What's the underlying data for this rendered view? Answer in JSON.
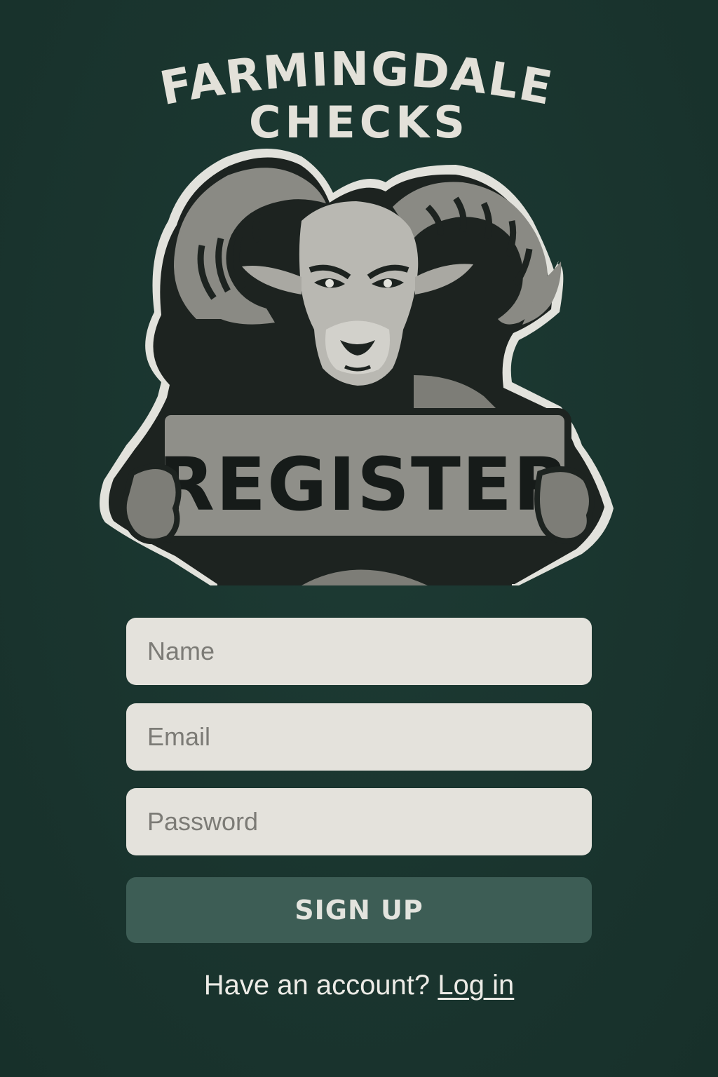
{
  "brand": {
    "line1": "FARMINGDALE",
    "line2": "CHECKS"
  },
  "mascot": {
    "icon": "ram-mascot-icon",
    "sign_text": "REGISTER"
  },
  "form": {
    "name_placeholder": "Name",
    "email_placeholder": "Email",
    "password_placeholder": "Password",
    "submit_label": "SIGN UP"
  },
  "footer": {
    "prompt": "Have an account?",
    "login_link": "Log in"
  },
  "colors": {
    "background": "#1b3630",
    "field_bg": "#e4e2dc",
    "button_bg": "#3d5d55",
    "text_light": "#e3e1d9"
  }
}
